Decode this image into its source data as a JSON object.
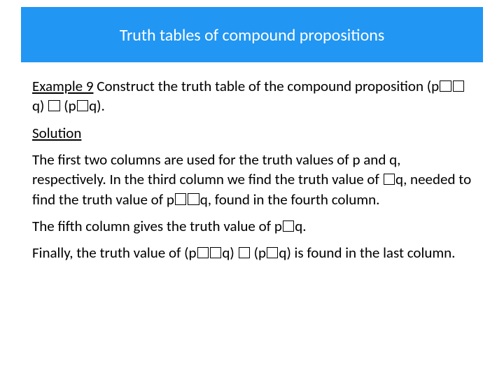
{
  "header": {
    "title": "Truth tables of compound propositions"
  },
  "body": {
    "example_label": "Example 9",
    "example_text_before": " Construct the truth table of the compound proposition (p",
    "example_text_mid": "q) ",
    "example_text_end1": " (p",
    "example_text_end2": "q).",
    "solution_label": "Solution",
    "p1a": "The first two columns are used for the truth values of p and q, respectively. In the third column we find the truth value of ",
    "p1b": "q, needed to find the truth value of p",
    "p1c": "q, found in the fourth column.",
    "p2a": "The fifth column gives the truth value of p",
    "p2b": "q.",
    "p3a": "Finally, the truth value of (p",
    "p3b": "q) ",
    "p3c": " (p",
    "p3d": "q) is found in the last column."
  }
}
